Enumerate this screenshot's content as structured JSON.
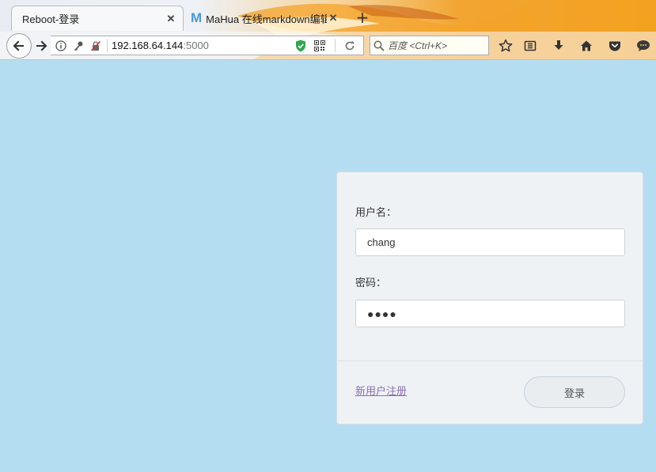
{
  "browser": {
    "tabs": [
      {
        "title": "Reboot-登录",
        "active": true
      },
      {
        "title": "MaHua 在线markdown编辑",
        "active": false
      }
    ],
    "address": {
      "host": "192.168.64.144",
      "port": ":5000"
    },
    "search": {
      "placeholder": "百度 <Ctrl+K>"
    },
    "icons": {
      "back": "arrow-left-icon",
      "forward": "arrow-right-icon",
      "info": "info-icon",
      "key": "key-icon",
      "insecure": "insecure-lock-icon",
      "shield": "shield-icon",
      "qr": "qr-code-icon",
      "reload": "reload-icon",
      "search": "magnifier-icon",
      "bookmark": "star-icon",
      "library": "library-icon",
      "download": "download-icon",
      "home": "home-icon",
      "pocket": "pocket-icon",
      "chat": "chat-icon",
      "close": "close-icon",
      "new_tab": "plus-icon"
    }
  },
  "login": {
    "username_label": "用户名：",
    "username_value": "chang",
    "password_label": "密码：",
    "password_value": "●●●●",
    "register_link": "新用户注册",
    "submit_label": "登录"
  },
  "colors": {
    "page_background": "#b5ddf1",
    "panel_background": "#eff2f5",
    "link": "#8c6fb5",
    "chrome_accent": "#f3a11f"
  }
}
